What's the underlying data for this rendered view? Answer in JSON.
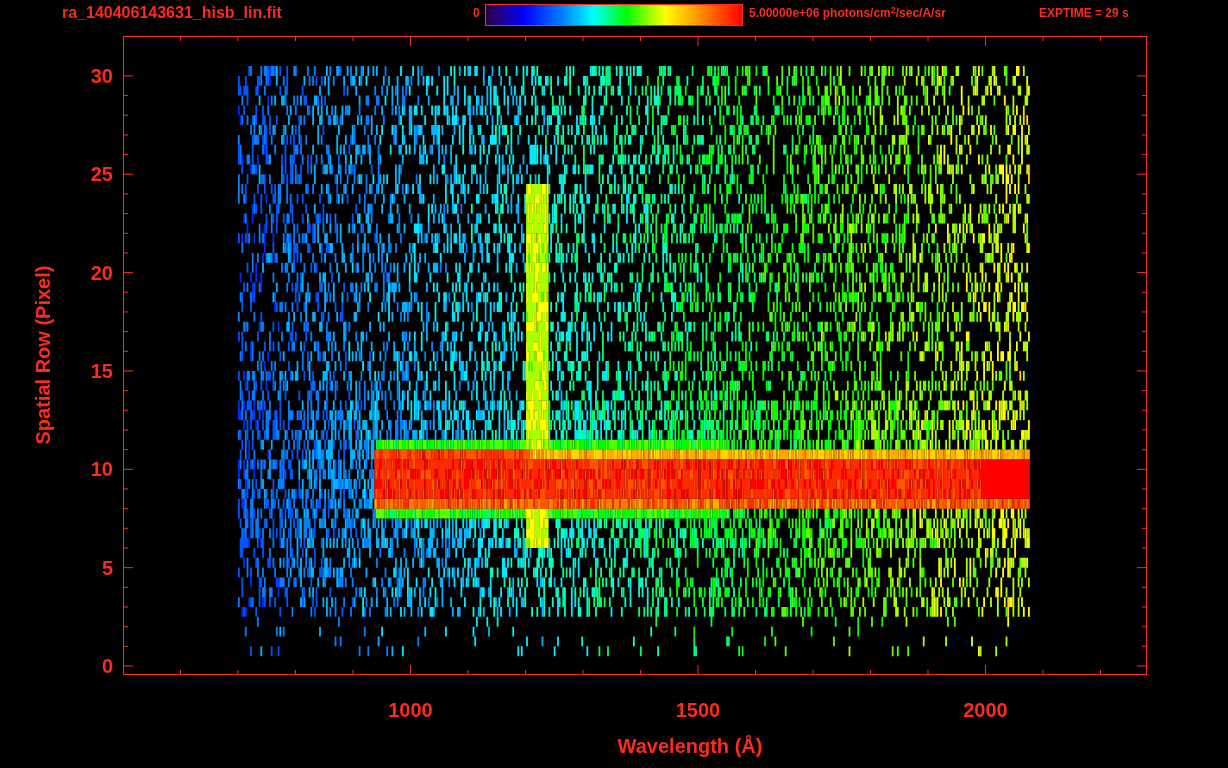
{
  "header": {
    "filename": "ra_140406143631_hisb_lin.fit",
    "colorbar_min": "0",
    "colorbar_max": "5.00000e+06 photons/cm$^{2}$/sec/A/sr",
    "exposure": "EXPTIME = 29 s"
  },
  "plot": {
    "ylabel": "Spatial Row (Pixel)",
    "xlabel": "Wavelength (Å)",
    "yticks": [
      "30",
      "25",
      "20",
      "15",
      "10",
      "5",
      "0"
    ],
    "xticks": [
      "1000",
      "1500",
      "2000"
    ]
  }
}
